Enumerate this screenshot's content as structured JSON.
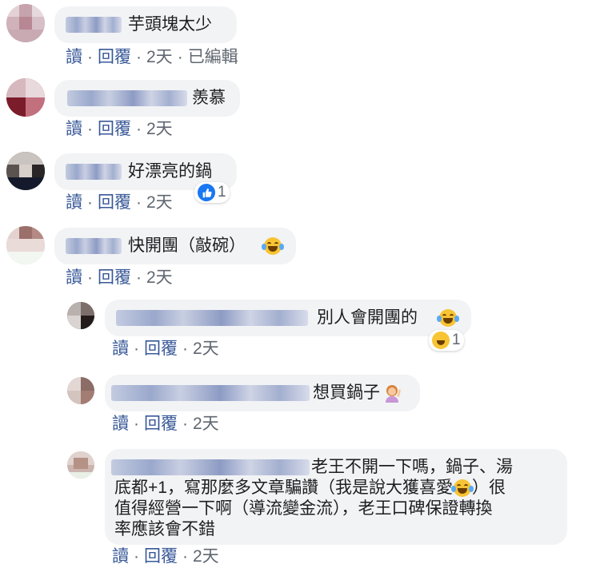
{
  "comments": [
    {
      "text": "芋頭塊太少",
      "actions": {
        "like": "讀",
        "reply": "回覆",
        "time": "2天",
        "edited": "已編輯"
      }
    },
    {
      "text": "羨慕",
      "actions": {
        "like": "讀",
        "reply": "回覆",
        "time": "2天"
      }
    },
    {
      "text": "好漂亮的鍋",
      "reaction_count": "1",
      "actions": {
        "like": "讀",
        "reply": "回覆",
        "time": "2天"
      }
    },
    {
      "text": "快開團（敲碗）",
      "actions": {
        "like": "讀",
        "reply": "回覆",
        "time": "2天"
      }
    }
  ],
  "replies": [
    {
      "text": "別人會開團的",
      "reaction_count": "1",
      "actions": {
        "like": "讀",
        "reply": "回覆",
        "time": "2天"
      }
    },
    {
      "text": "想買鍋子",
      "actions": {
        "like": "讀",
        "reply": "回覆",
        "time": "2天"
      }
    },
    {
      "text_line1": "老王不開一下嗎，鍋子、湯",
      "text_line2": "底都+1，寫那麼多文章騙讚（我是說大獲喜愛",
      "text_line2b": "）很",
      "text_line3": "值得經營一下啊（導流變金流），老王口碑保證轉換",
      "text_line4": "率應該會不錯",
      "actions": {
        "like": "讀",
        "reply": "回覆",
        "time": "2天"
      }
    }
  ],
  "separator": "·",
  "colors": {
    "link": "#385898",
    "bubble": "#f2f3f5",
    "like": "#1877f2",
    "haha": "#f7c433"
  }
}
